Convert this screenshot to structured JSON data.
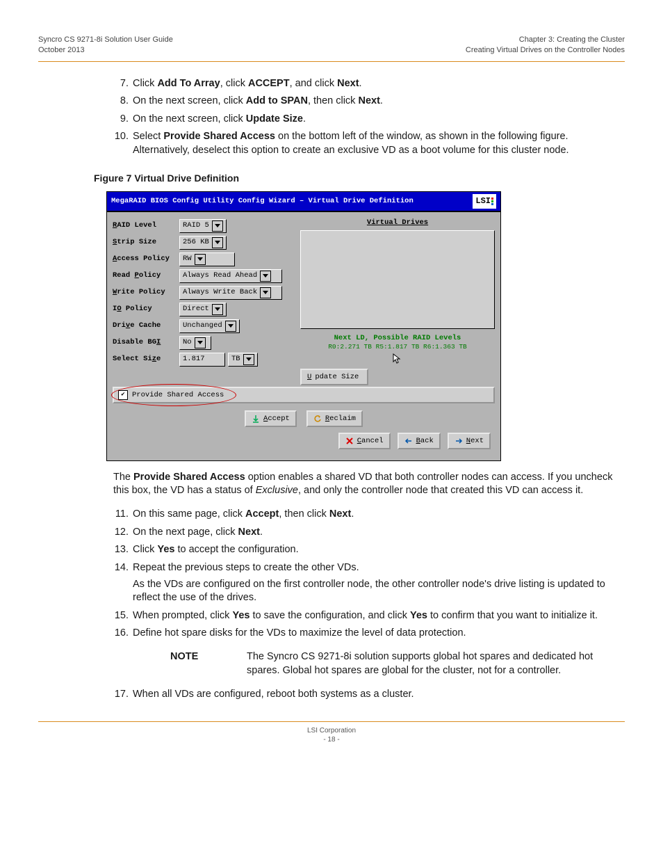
{
  "header": {
    "left_line1": "Syncro CS 9271-8i Solution User Guide",
    "left_line2": "October 2013",
    "right_line1": "Chapter 3:  Creating the Cluster",
    "right_line2": "Creating Virtual Drives on the Controller Nodes"
  },
  "steps_top": [
    {
      "n": "7.",
      "html": "Click <b>Add To Array</b>, click <b>ACCEPT</b>, and click <b>Next</b>."
    },
    {
      "n": "8.",
      "html": "On the next screen, click <b>Add to SPAN</b>, then click <b>Next</b>."
    },
    {
      "n": "9.",
      "html": "On the next screen, click <b>Update Size</b>."
    },
    {
      "n": "10.",
      "html": "Select <b>Provide Shared Access</b> on the bottom left of the window, as shown in the following figure. Alternatively, deselect this option to create an exclusive VD as a boot volume for this cluster node."
    }
  ],
  "figure_caption": "Figure 7  Virtual Drive Definition",
  "bios": {
    "title": "MegaRAID BIOS Config Utility  Config Wizard – Virtual Drive Definition",
    "logo": "LSI",
    "fields": {
      "raid_level": {
        "label_pre": "",
        "u": "R",
        "label_post": "AID Level",
        "value": "RAID 5"
      },
      "strip_size": {
        "label_pre": "",
        "u": "S",
        "label_post": "trip Size",
        "value": "256 KB"
      },
      "access_policy": {
        "label_pre": "",
        "u": "A",
        "label_post": "ccess Policy",
        "value": "RW"
      },
      "read_policy": {
        "label_pre": "Read ",
        "u": "P",
        "label_post": "olicy",
        "value": "Always Read Ahead"
      },
      "write_policy": {
        "label_pre": "",
        "u": "W",
        "label_post": "rite Policy",
        "value": "Always Write Back"
      },
      "io_policy": {
        "label_pre": "I",
        "u": "O",
        "label_post": " Policy",
        "value": "Direct"
      },
      "drive_cache": {
        "label_pre": "Dri",
        "u": "v",
        "label_post": "e Cache",
        "value": "Unchanged"
      },
      "disable_bgi": {
        "label_pre": "Disable BG",
        "u": "I",
        "label_post": "",
        "value": "No"
      },
      "select_size": {
        "label_pre": "Select Si",
        "u": "z",
        "label_post": "e",
        "value": "1.817",
        "unit": "TB"
      }
    },
    "vd_header": "Virtual Drives",
    "next_ld": "Next LD, Possible RAID Levels",
    "next_ld_sub": "R0:2.271 TB R5:1.817 TB R6:1.363 TB",
    "update_size": {
      "pre": "",
      "u": "U",
      "post": "pdate Size"
    },
    "provide_shared": "Provide Shared Access",
    "accept": {
      "u": "A",
      "post": "ccept"
    },
    "reclaim": {
      "u": "R",
      "post": "eclaim"
    },
    "cancel": {
      "u": "C",
      "post": "ancel"
    },
    "back": {
      "u": "B",
      "post": "ack"
    },
    "next": {
      "u": "N",
      "post": "ext"
    }
  },
  "para_after": "The <b>Provide Shared Access</b> option enables a shared VD that both controller nodes can access. If you uncheck this box, the VD has a status of <em>Exclusive</em>, and only the controller node that created this VD can access it.",
  "steps_bottom": [
    {
      "n": "11.",
      "html": "On this same page, click <b>Accept</b>, then click <b>Next</b>."
    },
    {
      "n": "12.",
      "html": "On the next page, click <b>Next</b>."
    },
    {
      "n": "13.",
      "html": "Click <b>Yes</b> to accept the configuration."
    },
    {
      "n": "14.",
      "html": "Repeat the previous steps to create the other VDs.",
      "sub": "As the VDs are configured on the first controller node, the other controller node's drive listing is updated to reflect the use of the drives."
    },
    {
      "n": "15.",
      "html": "When prompted, click <b>Yes</b> to save the configuration, and click <b>Yes</b> to confirm that you want to initialize it."
    },
    {
      "n": "16.",
      "html": "Define hot spare disks for the VDs to maximize the level of data protection."
    }
  ],
  "note": {
    "label": "NOTE",
    "body": "The Syncro CS 9271-8i solution supports global hot spares and dedicated hot spares. Global hot spares are global for the cluster, not for a controller."
  },
  "step17": {
    "n": "17.",
    "html": "When all VDs are configured, reboot both systems as a cluster."
  },
  "footer": {
    "line1": "LSI Corporation",
    "line2": "- 18 -"
  }
}
